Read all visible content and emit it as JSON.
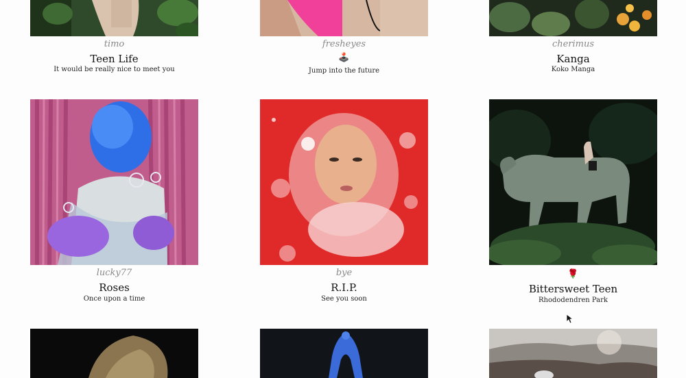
{
  "row1": [
    {
      "handle": "timo",
      "title": "Teen Life",
      "subtitle": "It would be really nice to meet you"
    },
    {
      "handle": "fresheyes",
      "emoji": "🕹️",
      "subtitle": "Jump into the future"
    },
    {
      "handle": "cherimus",
      "title": "Kanga",
      "subtitle": "Koko Manga"
    }
  ],
  "row2": [
    {
      "handle": "lucky77",
      "title": "Roses",
      "subtitle": "Once upon a time"
    },
    {
      "handle": "bye",
      "title": "R.I.P.",
      "subtitle": "See you soon"
    },
    {
      "emoji": "🌹",
      "title": "Bittersweet Teen",
      "subtitle": "Rhododendren Park"
    }
  ],
  "colors": {
    "background": "#fdfdfd",
    "handle": "#888888",
    "text": "#111111"
  }
}
